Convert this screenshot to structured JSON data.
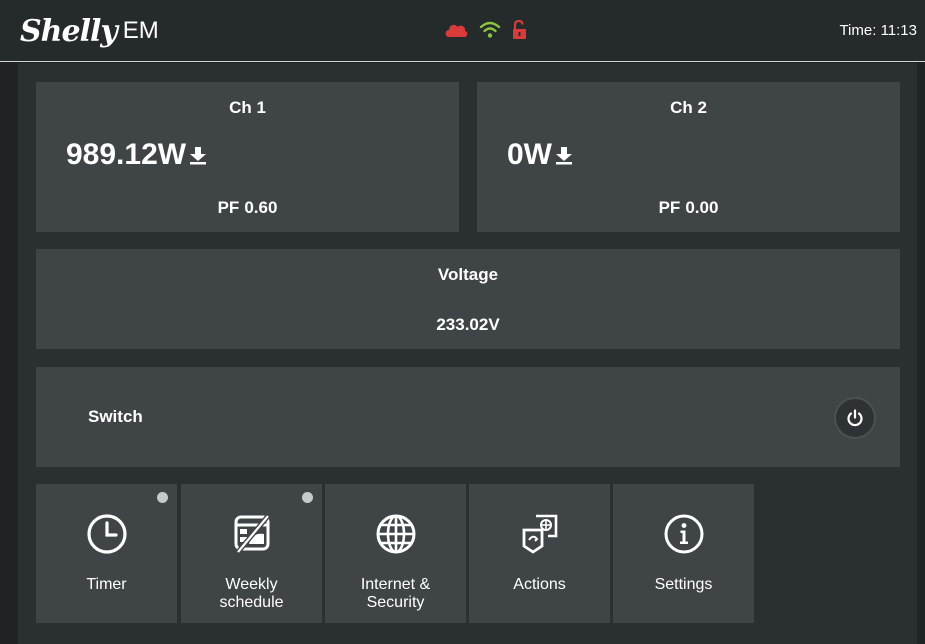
{
  "header": {
    "logo_text": "Shelly",
    "model": "EM",
    "time_label": "Time:",
    "time_value": "11:13",
    "icons": [
      "cloud-icon",
      "wifi-icon",
      "unlock-icon"
    ],
    "colors": {
      "cloud": "#d93b3b",
      "wifi": "#8cc63f",
      "lock": "#d93b3b"
    }
  },
  "channels": [
    {
      "title": "Ch 1",
      "power": "989.12W",
      "pf_label": "PF",
      "pf_value": "0.60"
    },
    {
      "title": "Ch 2",
      "power": "0W",
      "pf_label": "PF",
      "pf_value": "0.00"
    }
  ],
  "voltage": {
    "title": "Voltage",
    "value": "233.02V"
  },
  "switch": {
    "label": "Switch",
    "icon": "power-icon"
  },
  "tiles": [
    {
      "label": "Timer",
      "icon": "clock-icon",
      "indicator": true
    },
    {
      "label": "Weekly schedule",
      "line1": "Weekly",
      "line2": "schedule",
      "icon": "calendar-off-icon",
      "indicator": true
    },
    {
      "label": "Internet & Security",
      "line1": "Internet &",
      "line2": "Security",
      "icon": "globe-icon",
      "indicator": false
    },
    {
      "label": "Actions",
      "icon": "actions-icon",
      "indicator": false
    },
    {
      "label": "Settings",
      "icon": "info-icon",
      "indicator": false
    }
  ]
}
